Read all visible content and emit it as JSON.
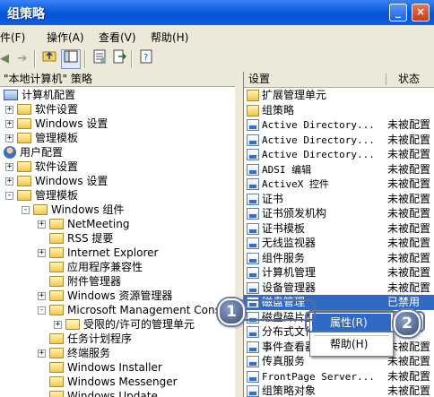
{
  "window": {
    "title": "组策略",
    "minimize_glyph": "_",
    "close_glyph": "×"
  },
  "menubar": {
    "items": [
      "文件(F)",
      "操作(A)",
      "查看(V)",
      "帮助(H)"
    ]
  },
  "toolbar": {
    "icons": [
      "back-icon",
      "forward-icon",
      "up-folder-icon",
      "show-hide-tree-icon",
      "properties-icon",
      "export-icon",
      "help-icon"
    ]
  },
  "left_pane": {
    "header": "\"本地计算机\" 策略",
    "tree": [
      {
        "label": "计算机配置",
        "icon": "computer-icon"
      },
      {
        "label": "软件设置",
        "icon": "folder-icon",
        "expander": "+"
      },
      {
        "label": "Windows 设置",
        "icon": "folder-icon",
        "expander": "+"
      },
      {
        "label": "管理模板",
        "icon": "folder-icon",
        "expander": "+"
      },
      {
        "label": "用户配置",
        "icon": "user-icon"
      },
      {
        "label": "软件设置",
        "icon": "folder-icon",
        "expander": "+"
      },
      {
        "label": "Windows 设置",
        "icon": "folder-icon",
        "expander": "+"
      },
      {
        "label": "管理模板",
        "icon": "folder-icon",
        "expander": "-"
      },
      {
        "label": "Windows 组件",
        "icon": "folder-icon",
        "expander": "-"
      },
      {
        "label": "NetMeeting",
        "icon": "folder-icon",
        "expander": "+"
      },
      {
        "label": "RSS 提要",
        "icon": "folder-icon"
      },
      {
        "label": "Internet Explorer",
        "icon": "folder-icon",
        "expander": "+"
      },
      {
        "label": "应用程序兼容性",
        "icon": "folder-icon"
      },
      {
        "label": "附件管理器",
        "icon": "folder-icon"
      },
      {
        "label": "Windows 资源管理器",
        "icon": "folder-icon",
        "expander": "+"
      },
      {
        "label": "Microsoft Management Console",
        "icon": "folder-icon",
        "expander": "-"
      },
      {
        "label": "受限的/许可的管理单元",
        "icon": "folder-open-icon",
        "expander": "+"
      },
      {
        "label": "任务计划程序",
        "icon": "folder-icon"
      },
      {
        "label": "终端服务",
        "icon": "folder-icon",
        "expander": "+"
      },
      {
        "label": "Windows Installer",
        "icon": "folder-icon"
      },
      {
        "label": "Windows Messenger",
        "icon": "folder-icon"
      },
      {
        "label": "Windows Update",
        "icon": "folder-icon"
      }
    ]
  },
  "right_pane": {
    "columns": [
      "设置",
      "状态"
    ],
    "rows": [
      {
        "name": "扩展管理单元",
        "state": "",
        "icon": "folder-icon"
      },
      {
        "name": "组策略",
        "state": "",
        "icon": "folder-icon"
      },
      {
        "name": "Active Directory...",
        "state": "未被配置",
        "icon": "policy-setting-icon"
      },
      {
        "name": "Active Directory...",
        "state": "未被配置",
        "icon": "policy-setting-icon"
      },
      {
        "name": "Active Directory...",
        "state": "未被配置",
        "icon": "policy-setting-icon"
      },
      {
        "name": "ADSI 编辑",
        "state": "未被配置",
        "icon": "policy-setting-icon"
      },
      {
        "name": "ActiveX 控件",
        "state": "未被配置",
        "icon": "policy-setting-icon"
      },
      {
        "name": "证书",
        "state": "未被配置",
        "icon": "policy-setting-icon"
      },
      {
        "name": "证书颁发机构",
        "state": "未被配置",
        "icon": "policy-setting-icon"
      },
      {
        "name": "证书模板",
        "state": "未被配置",
        "icon": "policy-setting-icon"
      },
      {
        "name": "无线监视器",
        "state": "未被配置",
        "icon": "policy-setting-icon"
      },
      {
        "name": "组件服务",
        "state": "未被配置",
        "icon": "policy-setting-icon"
      },
      {
        "name": "计算机管理",
        "state": "未被配置",
        "icon": "policy-setting-icon"
      },
      {
        "name": "设备管理器",
        "state": "未被配置",
        "icon": "policy-setting-icon"
      },
      {
        "name": "磁盘管理",
        "state": "已禁用",
        "icon": "policy-setting-icon",
        "selected": true
      },
      {
        "name": "磁盘碎片整",
        "state": "",
        "icon": "policy-setting-icon"
      },
      {
        "name": "分布式文件",
        "state": "",
        "icon": "policy-setting-icon"
      },
      {
        "name": "事件查看器",
        "state": "未被配置",
        "icon": "policy-setting-icon"
      },
      {
        "name": "传真服务",
        "state": "未被配置",
        "icon": "policy-setting-icon"
      },
      {
        "name": "FrontPage Server...",
        "state": "未被配置",
        "icon": "policy-setting-icon"
      },
      {
        "name": "组策略对象",
        "state": "未被配置",
        "icon": "policy-setting-icon"
      }
    ]
  },
  "context_menu": {
    "items": [
      "属性(R)",
      "帮助(H)"
    ]
  },
  "callouts": [
    "1",
    "2"
  ],
  "colors": {
    "selection": "#316ac5",
    "titlebar": "#0a5ce0"
  }
}
